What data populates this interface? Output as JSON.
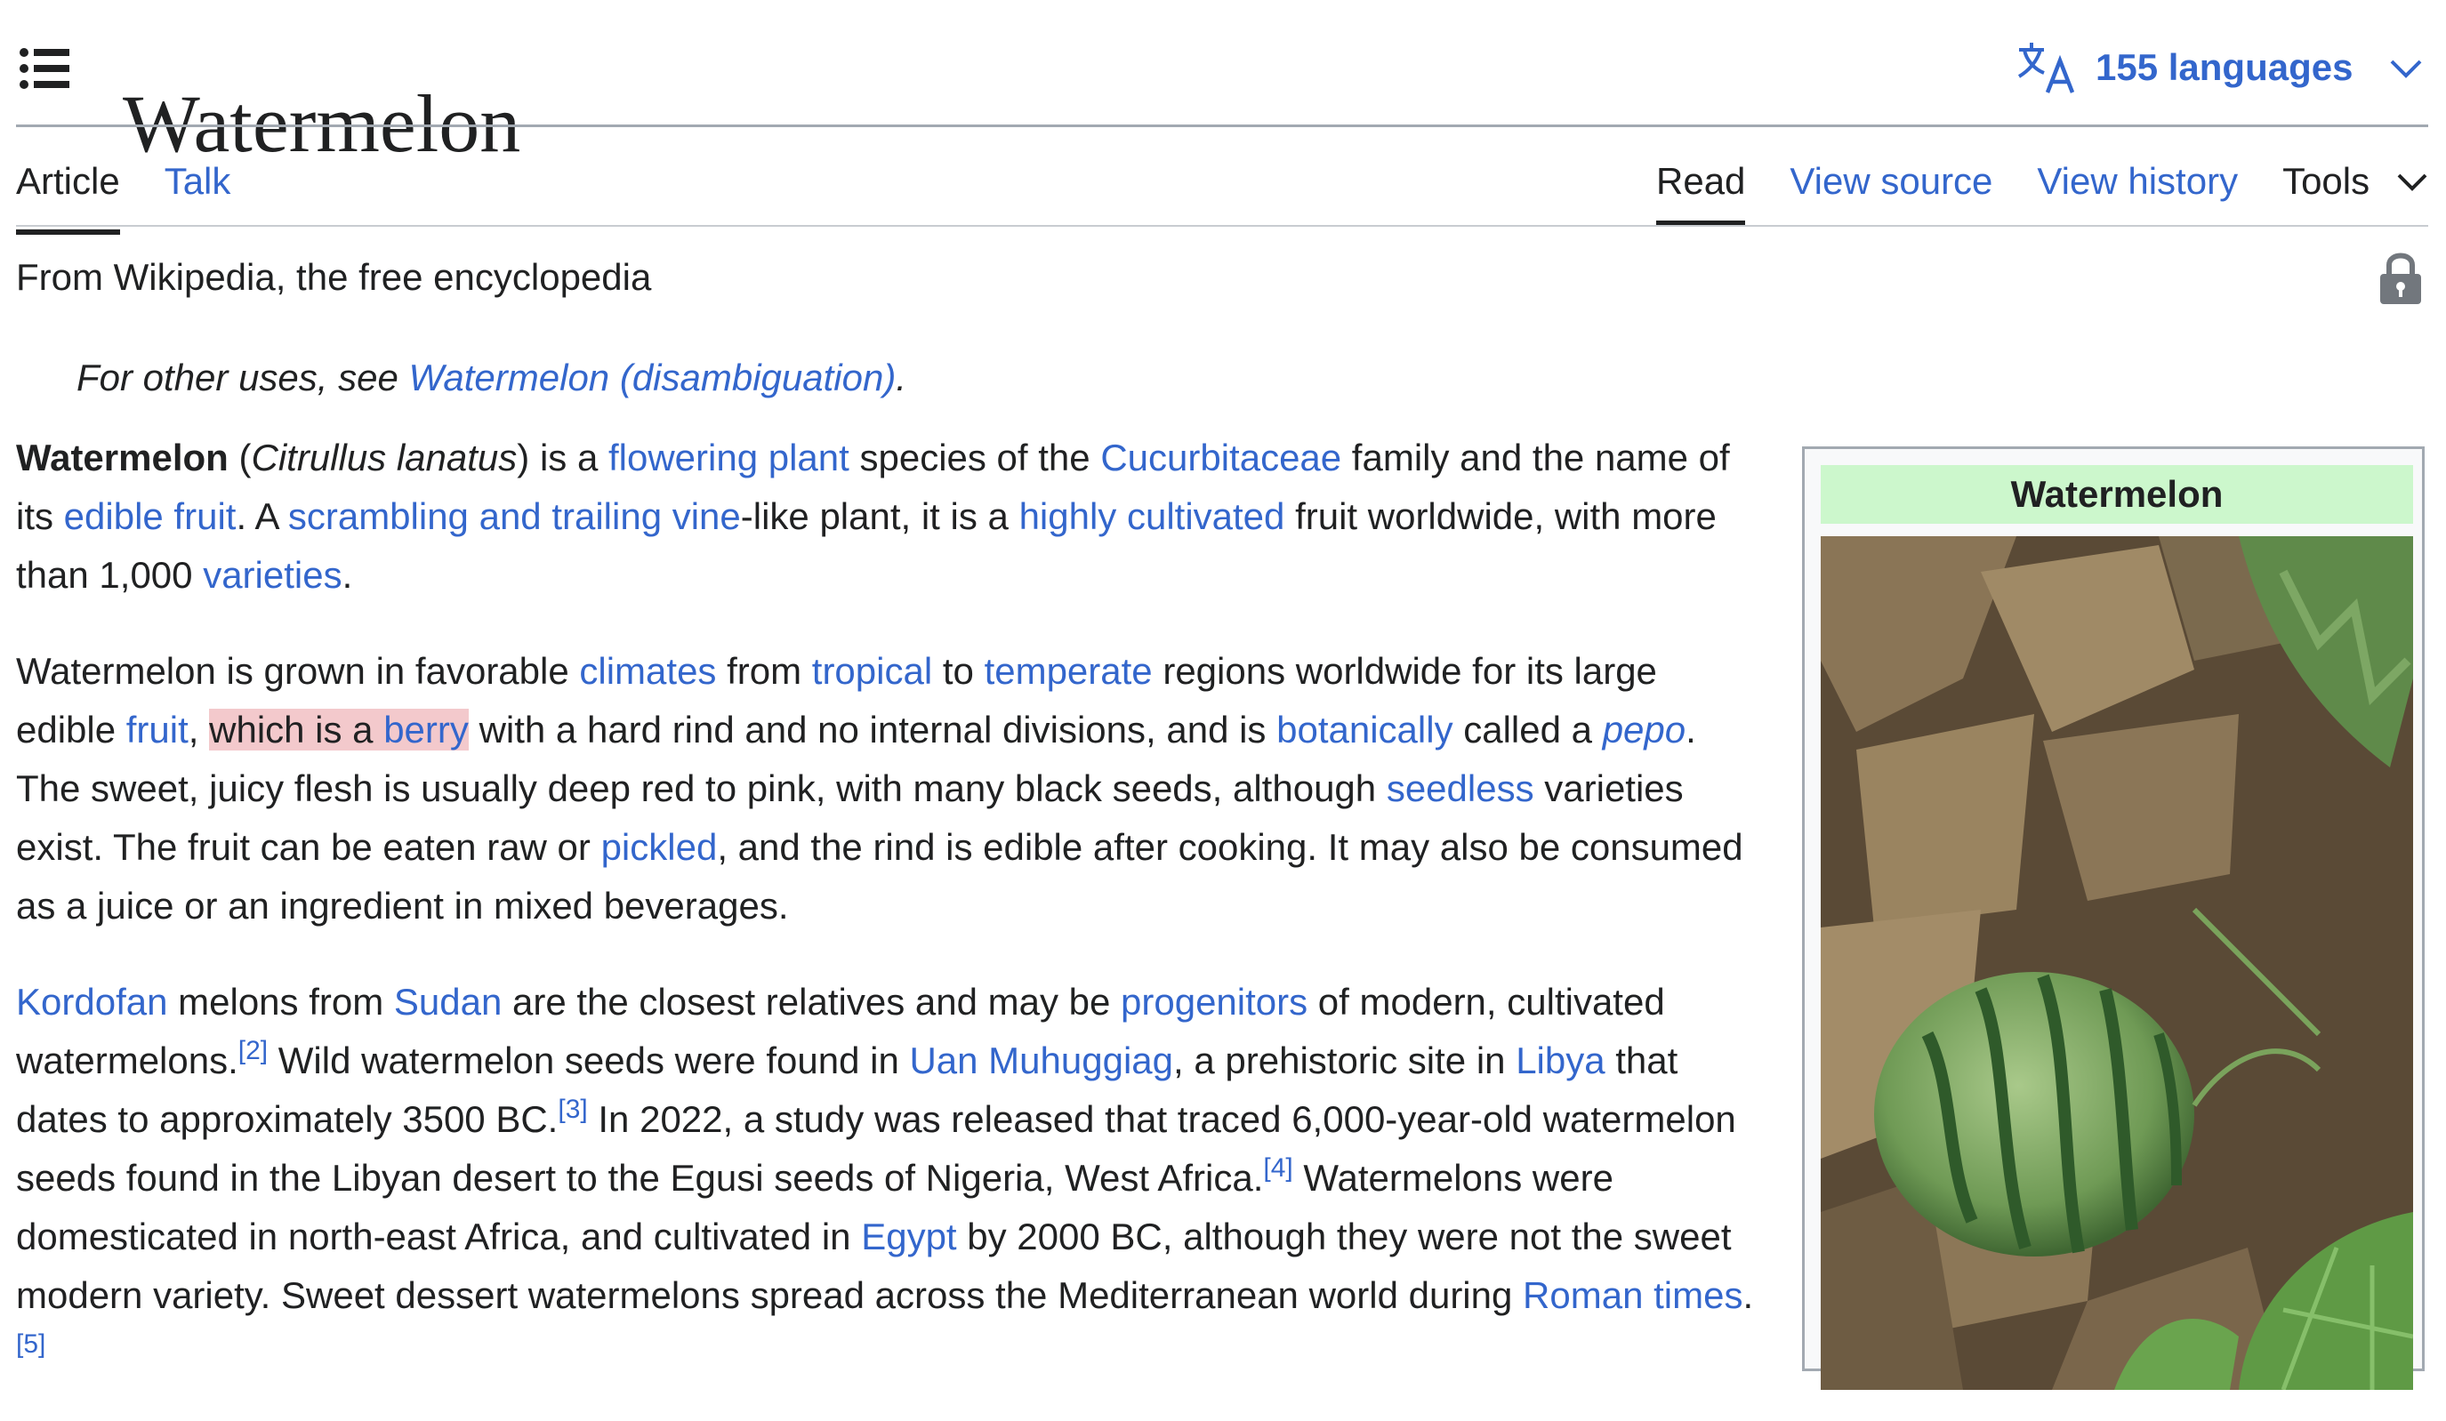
{
  "header": {
    "title": "Watermelon",
    "languages_label": "155 languages"
  },
  "tabs": {
    "article": "Article",
    "talk": "Talk",
    "read": "Read",
    "view_source": "View source",
    "view_history": "View history",
    "tools": "Tools"
  },
  "tagline": "From Wikipedia, the free encyclopedia",
  "hatnote": {
    "prefix": "For other uses, see ",
    "link": "Watermelon (disambiguation)",
    "suffix": "."
  },
  "infobox": {
    "title": "Watermelon"
  },
  "paragraphs": {
    "p1": {
      "bold": "Watermelon",
      "t1": " (",
      "sci": "Citrullus lanatus",
      "t2": ") is a ",
      "l1": "flowering plant",
      "t3": " species of the ",
      "l2": "Cucurbitaceae",
      "t4": " family and the name of its ",
      "l3": "edible fruit",
      "t5": ". A ",
      "l4": "scrambling and trailing vine",
      "t6": "-like plant, it is a ",
      "l5": "highly cultivated",
      "t7": " fruit worldwide, with more than 1,000 ",
      "l6": "varieties",
      "t8": "."
    },
    "p2": {
      "t1": "Watermelon is grown in favorable ",
      "l1": "climates",
      "t2": " from ",
      "l2": "tropical",
      "t3": " to ",
      "l3": "temperate",
      "t4": " regions worldwide for its large edible ",
      "l4": "fruit",
      "t5": ", ",
      "hl": "which is a ",
      "l5": "berry",
      "t6": " with a hard rind and no internal divisions, and is ",
      "l6": "botanically",
      "t7": " called a ",
      "l7": "pepo",
      "t8": ". The sweet, juicy flesh is usually deep red to pink, with many black seeds, although ",
      "l8": "seedless",
      "t9": " varieties exist. The fruit can be eaten raw or ",
      "l9": "pickled",
      "t10": ", and the rind is edible after cooking. It may also be consumed as a juice or an ingredient in mixed beverages."
    },
    "p3": {
      "l1": "Kordofan",
      "t1": " melons from ",
      "l2": "Sudan",
      "t2": " are the closest relatives and may be ",
      "l3": "progenitors",
      "t3": " of modern, cultivated watermelons.",
      "r1": "[2]",
      "t4": " Wild watermelon seeds were found in ",
      "l4": "Uan Muhuggiag",
      "t5": ", a prehistoric site in ",
      "l5": "Libya",
      "t6": " that dates to approximately 3500 BC.",
      "r2": "[3]",
      "t7": " In 2022, a study was released that traced 6,000-year-old watermelon seeds found in the Libyan desert to the Egusi seeds of Nigeria, West Africa.",
      "r3": "[4]",
      "t8": " Watermelons were domesticated in north-east Africa, and cultivated in ",
      "l6": "Egypt",
      "t9": " by 2000 BC, although they were not the sweet modern variety. Sweet dessert watermelons spread across the Mediterranean world during ",
      "l7": "Roman times",
      "t10": ".",
      "r4": "[5]"
    }
  }
}
